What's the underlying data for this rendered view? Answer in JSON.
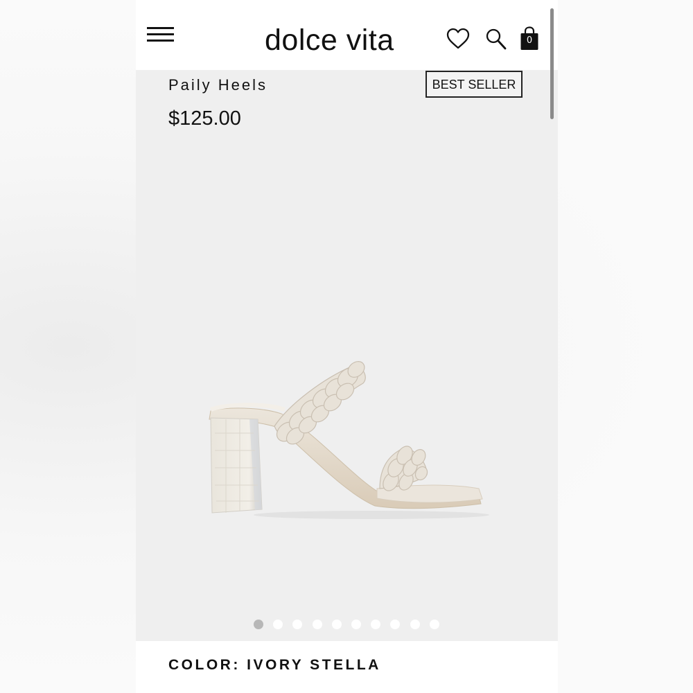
{
  "header": {
    "logo": "dolce vita",
    "cart_count": "0",
    "icons": [
      "menu-icon",
      "heart-icon",
      "search-icon",
      "shopping-bag-icon"
    ]
  },
  "product": {
    "title": "Paily Heels",
    "badge": "BEST SELLER",
    "price": "$125.00",
    "color_label": "COLOR: IVORY STELLA"
  },
  "gallery": {
    "image_count": 10,
    "active_index": 0
  },
  "colors": {
    "header_bg": "#ffffff",
    "gallery_bg": "#efefef",
    "shoe_ivory": "#e9e2d6",
    "dot_active": "#b7b7b7",
    "dot_inactive": "#ffffff"
  }
}
